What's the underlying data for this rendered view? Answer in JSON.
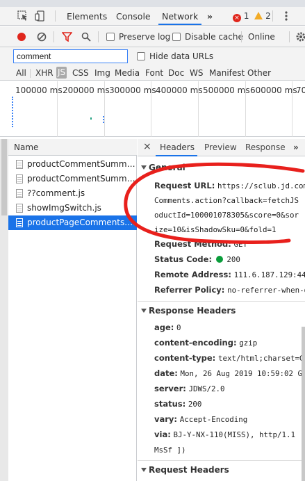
{
  "tabbar": {
    "tabs": [
      "Elements",
      "Console",
      "Network"
    ],
    "more": "»",
    "errors": "1",
    "warnings": "2"
  },
  "toolbar": {
    "preserve_log": "Preserve log",
    "disable_cache": "Disable cache",
    "online": "Online"
  },
  "filter": {
    "value": "comment",
    "hide_data_urls": "Hide data URLs"
  },
  "types": [
    "All",
    "XHR",
    "JS",
    "CSS",
    "Img",
    "Media",
    "Font",
    "Doc",
    "WS",
    "Manifest",
    "Other"
  ],
  "timeline": {
    "ticks": [
      "100000 ms",
      "200000 ms",
      "300000 ms",
      "400000 ms",
      "500000 ms",
      "600000 ms",
      "700"
    ]
  },
  "requests": {
    "header": "Name",
    "items": [
      "productCommentSummari...",
      "productCommentSummari...",
      "??comment.js",
      "showImgSwitch.js",
      "productPageComments.act..."
    ]
  },
  "detail": {
    "close": "×",
    "tabs": [
      "Headers",
      "Preview",
      "Response",
      "»"
    ],
    "general": {
      "title": "General",
      "request_url_label": "Request URL:",
      "request_url_lines": [
        "https://sclub.jd.com",
        "Comments.action?callback=fetchJS",
        "oductId=100001078305&score=0&sor",
        "ize=10&isShadowSku=0&fold=1"
      ],
      "method_label": "Request Method:",
      "method_value": "GET",
      "status_label": "Status Code:",
      "status_value": "200",
      "remote_label": "Remote Address:",
      "remote_value": "111.6.187.129:443",
      "referrer_label": "Referrer Policy:",
      "referrer_value": "no-referrer-when-d"
    },
    "response_headers": {
      "title": "Response Headers",
      "items": [
        {
          "k": "age:",
          "v": "0"
        },
        {
          "k": "content-encoding:",
          "v": "gzip"
        },
        {
          "k": "content-type:",
          "v": "text/html;charset=GE"
        },
        {
          "k": "date:",
          "v": "Mon, 26 Aug 2019 10:59:02 G"
        },
        {
          "k": "server:",
          "v": "JDWS/2.0"
        },
        {
          "k": "status:",
          "v": "200"
        },
        {
          "k": "vary:",
          "v": "Accept-Encoding"
        },
        {
          "k": "via:",
          "v": "BJ-Y-NX-110(MISS), http/1.1"
        }
      ],
      "via_cont": "MsSf ])"
    },
    "request_headers": {
      "title": "Request Headers"
    }
  },
  "colors": {
    "accent": "#1a73e8",
    "annotation": "#e8201c",
    "status_ok": "#0a9d3b"
  }
}
